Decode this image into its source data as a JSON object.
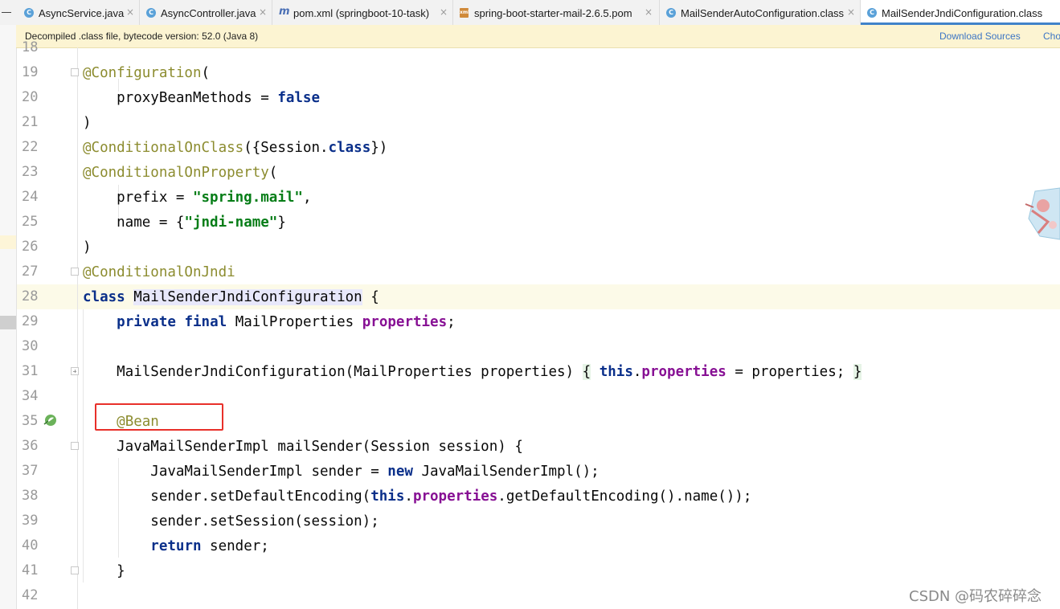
{
  "tabs": [
    {
      "label": "AsyncService.java",
      "icon": "class-c-icon"
    },
    {
      "label": "AsyncController.java",
      "icon": "class-c-icon"
    },
    {
      "label": "pom.xml (springboot-10-task)",
      "icon": "maven-m-icon"
    },
    {
      "label": "spring-boot-starter-mail-2.6.5.pom",
      "icon": "pom-file-icon"
    },
    {
      "label": "MailSenderAutoConfiguration.class",
      "icon": "class-c-icon"
    },
    {
      "label": "MailSenderJndiConfiguration.class",
      "icon": "class-c-icon",
      "active": true
    }
  ],
  "notice": {
    "text": "Decompiled .class file, bytecode version: 52.0 (Java 8)",
    "download_sources": "Download Sources",
    "choose_sources": "Cho"
  },
  "gutter": {
    "line_numbers": [
      "18",
      "19",
      "20",
      "21",
      "22",
      "23",
      "24",
      "25",
      "26",
      "27",
      "28",
      "29",
      "30",
      "31",
      "34",
      "35",
      "36",
      "37",
      "38",
      "39",
      "40",
      "41",
      "42"
    ]
  },
  "code": {
    "l19_annotation": "@Configuration",
    "l19_paren": "(",
    "l20_name": "    proxyBeanMethods = ",
    "l20_value": "false",
    "l21": ")",
    "l22_annotation": "@ConditionalOnClass",
    "l22_rest_a": "({Session.",
    "l22_kw": "class",
    "l22_rest_b": "})",
    "l23_annotation": "@ConditionalOnProperty",
    "l23_paren": "(",
    "l24_name": "    prefix = ",
    "l24_value": "\"spring.mail\"",
    "l24_comma": ",",
    "l25_name": "    name = {",
    "l25_value": "\"jndi-name\"",
    "l25_close": "}",
    "l26": ")",
    "l27_annotation": "@ConditionalOnJndi",
    "l28_kw": "class",
    "l28_name": "MailSenderJndiConfiguration",
    "l28_brace": "{",
    "l29_kw1": "private",
    "l29_kw2": "final",
    "l29_type": "MailProperties",
    "l29_field": "properties",
    "l29_semi": ";",
    "l31_sig": "    MailSenderJndiConfiguration(MailProperties properties) ",
    "l31_open": "{",
    "l31_this": "this",
    "l31_dot": ".",
    "l31_field": "properties",
    "l31_assign": " = properties; ",
    "l31_close": "}",
    "l35_annotation": "@Bean",
    "l36": "    JavaMailSenderImpl mailSender(Session session) {",
    "l37_a": "        JavaMailSenderImpl sender = ",
    "l37_kw": "new",
    "l37_b": " JavaMailSenderImpl();",
    "l38_a": "        sender.setDefaultEncoding(",
    "l38_this": "this",
    "l38_dot": ".",
    "l38_field": "properties",
    "l38_b": ".getDefaultEncoding().name());",
    "l39": "        sender.setSession(session);",
    "l40_kw": "return",
    "l40_rest": " sender;",
    "l41": "    }"
  },
  "watermark": "CSDN @码农碎碎念",
  "colors": {
    "keyword": "#0a2f8a",
    "annotation": "#8c8c2f",
    "string": "#067d17",
    "field": "#871094",
    "highlight_box": "#e8302a",
    "notice_bg": "#fcf4d2",
    "active_tab_underline": "#4083c9"
  }
}
